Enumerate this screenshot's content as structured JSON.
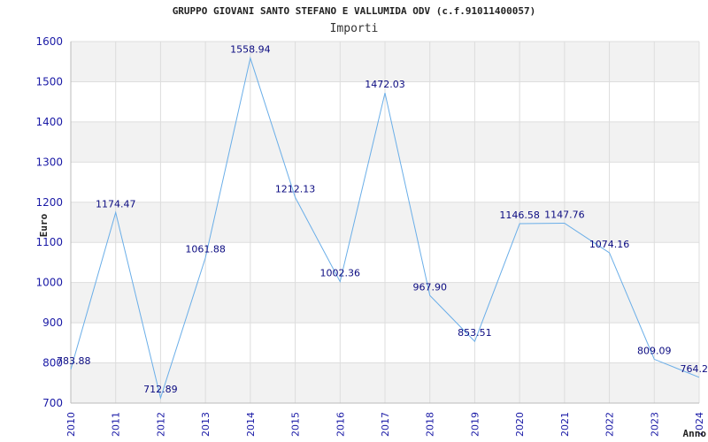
{
  "title": "GRUPPO GIOVANI SANTO STEFANO E VALLUMIDA ODV (c.f.91011400057)",
  "subtitle": "Importi",
  "colors": {
    "line": "#6aaee8",
    "band": "#f2f2f2",
    "grid": "#dddddd",
    "tick_text": "#1a1aa6",
    "label_text": "#0a0a80"
  },
  "chart_data": {
    "type": "line",
    "title": "GRUPPO GIOVANI SANTO STEFANO E VALLUMIDA ODV (c.f.91011400057)",
    "subtitle": "Importi",
    "xlabel": "Anno",
    "ylabel": "Euro",
    "x": [
      "2010",
      "2011",
      "2012",
      "2013",
      "2014",
      "2015",
      "2016",
      "2017",
      "2018",
      "2019",
      "2020",
      "2021",
      "2022",
      "2023",
      "2024"
    ],
    "values": [
      783.88,
      1174.47,
      712.89,
      1061.88,
      1558.94,
      1212.13,
      1002.36,
      1472.03,
      967.9,
      853.51,
      1146.58,
      1147.76,
      1074.16,
      809.09,
      764.2
    ],
    "labels": [
      "783.88",
      "1174.47",
      "712.89",
      "1061.88",
      "1558.94",
      "1212.13",
      "1002.36",
      "1472.03",
      "967.90",
      "853.51",
      "1146.58",
      "1147.76",
      "1074.16",
      "809.09",
      "764.2"
    ],
    "ylim": [
      700,
      1600
    ],
    "yticks": [
      700,
      800,
      900,
      1000,
      1100,
      1200,
      1300,
      1400,
      1500,
      1600
    ],
    "grid": true
  }
}
